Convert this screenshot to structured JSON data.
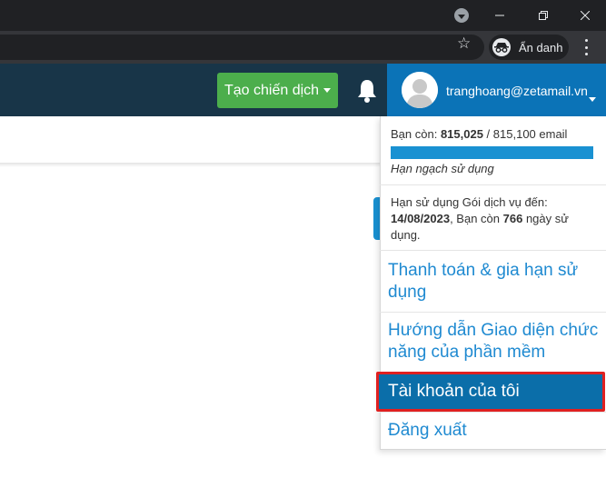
{
  "browser": {
    "incognito_label": "Ẩn danh"
  },
  "header": {
    "create_campaign_label": "Tạo chiến dịch",
    "user_email": "tranghoang@zetamail.vn"
  },
  "account_menu": {
    "quota_prefix": "Bạn còn: ",
    "quota_remaining": "815,025",
    "quota_separator": " / ",
    "quota_total": "815,100 email",
    "quota_used_fraction": 0.9999,
    "quota_caption": "Hạn ngạch sử dụng",
    "expiry_prefix": "Hạn sử dụng Gói dịch vụ đến:",
    "expiry_date": "14/08/2023",
    "expiry_middle": ", Bạn còn ",
    "days_left": "766",
    "expiry_suffix": " ngày sử dụng.",
    "items": [
      {
        "label": "Thanh toán & gia hạn sử dụng"
      },
      {
        "label": "Hướng dẫn Giao diện chức năng của phần mềm"
      },
      {
        "label": "Tài khoản của tôi"
      },
      {
        "label": "Đăng xuất"
      }
    ]
  },
  "theme": {
    "header_bg": "#183548",
    "user_area_bg": "#0b73b7",
    "create_button_bg": "#4cae4c",
    "link_color": "#1f8ad1",
    "active_item_bg": "#0b6ea9",
    "highlight_border": "#e02020"
  }
}
